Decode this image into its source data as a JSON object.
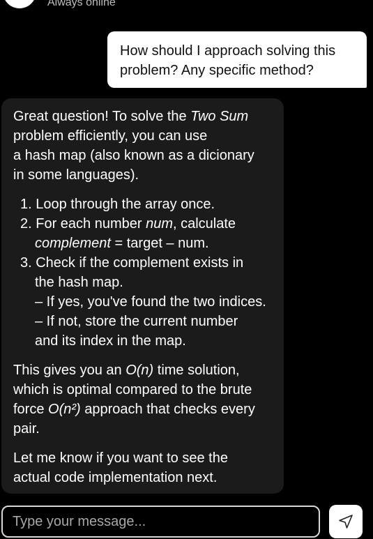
{
  "header": {
    "status": "Always online"
  },
  "user_message": {
    "lines": [
      "How should I approach solving this",
      "problem? Any specific method?"
    ]
  },
  "assistant_message": {
    "intro": [
      [
        "Great question! To solve the ",
        "Two Sum"
      ],
      "problem efficiently, you can use",
      "a hash map (also known as a dicionary",
      "in some languages)."
    ],
    "steps": {
      "s1": "1. Loop through the array once.",
      "s2_a": "2. For each number ",
      "s2_b": "num",
      "s2_c": ", calculate",
      "s2_d": "complement",
      "s2_e": " = target – num.",
      "s3_a": "3. Check if the complement exists in",
      "s3_b": "the hash map.",
      "s3_c": "– If yes, you've found the two indices.",
      "s3_d": "– If not, store the current number",
      "s3_e": "and its index in the map."
    },
    "complexity": {
      "a1": "This gives you an ",
      "a2": "O(n)",
      "a3": " time solution,",
      "b": "which is optimal compared to the brute",
      "c1": "force ",
      "c2": "O(n²)",
      "c3": " approach that checks every",
      "d": "pair."
    },
    "closing": [
      "Let me know if you want to see the",
      "actual code implementation next."
    ]
  },
  "composer": {
    "placeholder": "Type your message...",
    "value": "",
    "send_icon": "send-icon"
  }
}
